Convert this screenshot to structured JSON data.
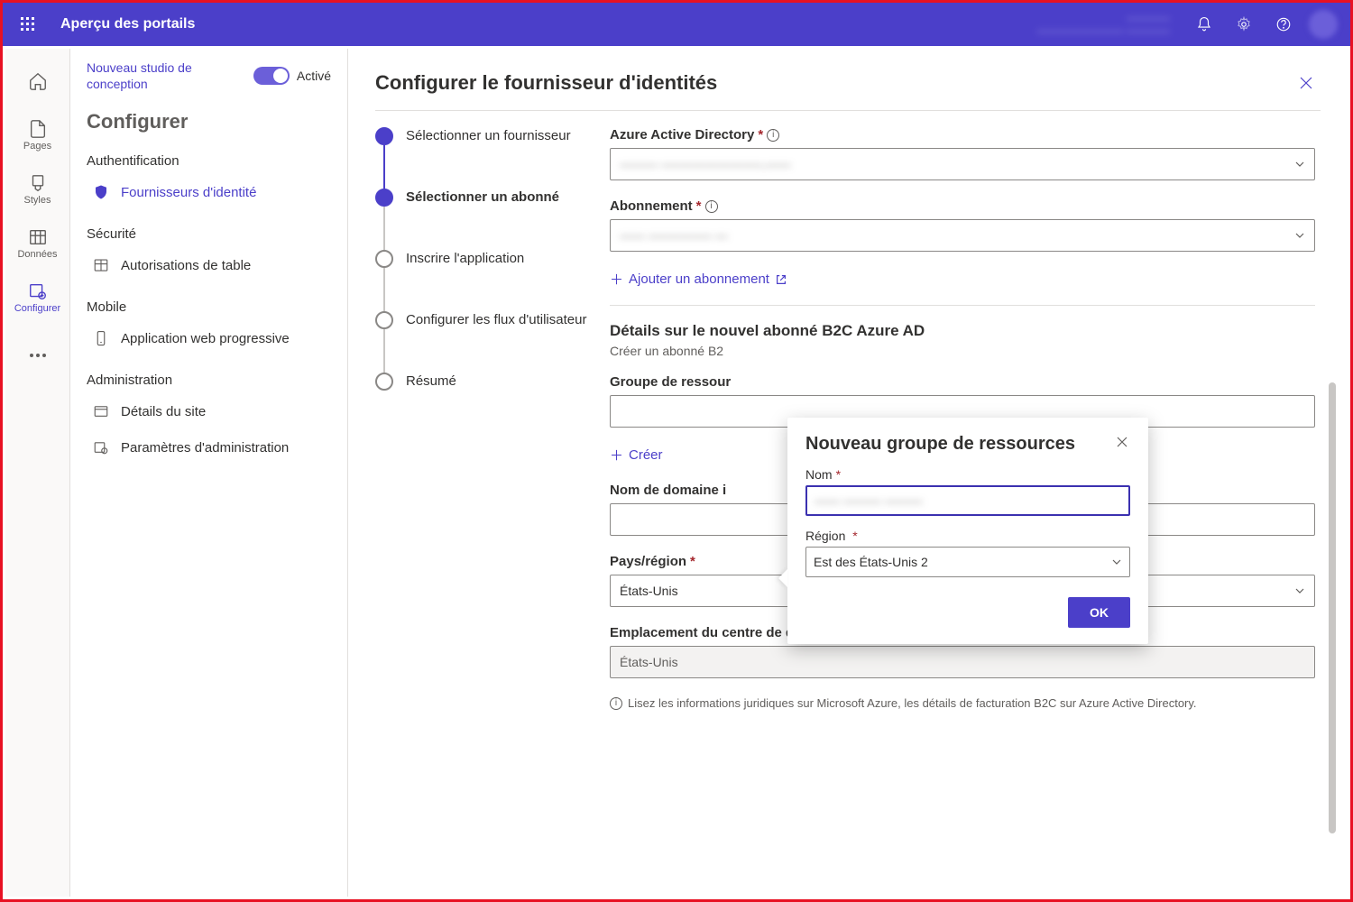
{
  "topbar": {
    "title": "Aperçu des portails",
    "user_line1": "————",
    "user_line2": "———————— ————"
  },
  "rail": {
    "home": "",
    "pages": "Pages",
    "styles": "Styles",
    "data": "Données",
    "configure": "Configurer"
  },
  "sidebar": {
    "studio_label": "Nouveau studio de conception",
    "toggle_label": "Activé",
    "title": "Configurer",
    "auth_heading": "Authentification",
    "identity_providers": "Fournisseurs d'identité",
    "security_heading": "Sécurité",
    "table_permissions": "Autorisations de table",
    "mobile_heading": "Mobile",
    "pwa": "Application web progressive",
    "admin_heading": "Administration",
    "site_details": "Détails du site",
    "admin_settings": "Paramètres d'administration"
  },
  "panel": {
    "title": "Configurer le fournisseur d'identités"
  },
  "steps": {
    "s1": "Sélectionner un fournisseur",
    "s2": "Sélectionner un abonné",
    "s3": "Inscrire l'application",
    "s4": "Configurer les flux d'utilisateur",
    "s5": "Résumé"
  },
  "form": {
    "aad_label": "Azure Active Directory",
    "aad_value": "——— ————————.——",
    "sub_label": "Abonnement",
    "sub_value": "—— ————— —",
    "add_sub": "Ajouter un abonnement",
    "b2c_title": "Détails sur le nouvel abonné B2C Azure AD",
    "b2c_sub": "Créer un abonné B2",
    "rg_label": "Groupe de ressour",
    "create": "Créer",
    "domain_label": "Nom de domaine i",
    "country_label": "Pays/région",
    "country_value": "États-Unis",
    "dc_label": "Emplacement du centre de données",
    "dc_value": "États-Unis",
    "legal": "Lisez les informations juridiques sur Microsoft Azure, les détails de facturation B2C sur Azure Active Directory."
  },
  "popover": {
    "title": "Nouveau groupe de ressources",
    "name_label": "Nom",
    "name_value": "—— ——— ———",
    "region_label": "Région",
    "region_value": "Est des États-Unis 2",
    "ok": "OK"
  }
}
